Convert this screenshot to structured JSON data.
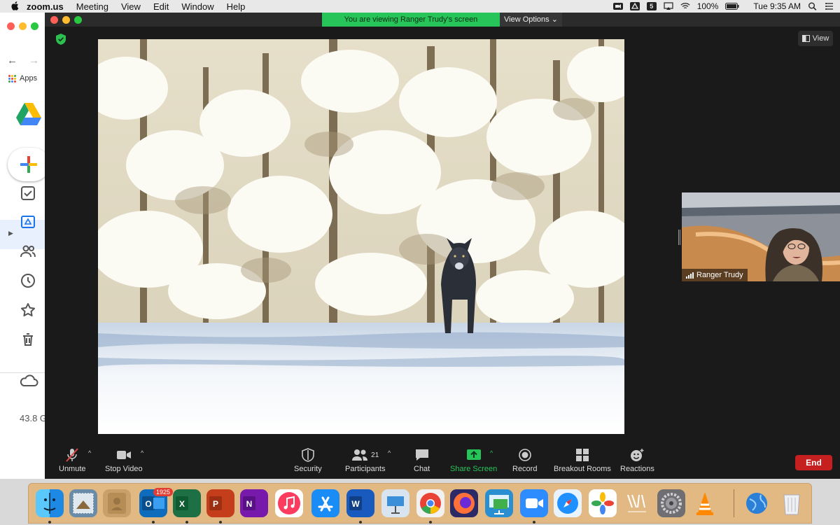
{
  "menubar": {
    "app_name": "zoom.us",
    "items": [
      "Meeting",
      "View",
      "Edit",
      "Window",
      "Help"
    ],
    "battery": "100%",
    "clock": "Tue 9:35 AM",
    "badge_five": "5"
  },
  "chrome": {
    "apps_label": "Apps",
    "storage_text": "43.8 G"
  },
  "zoom": {
    "banner": "You are viewing Ranger Trudy's screen",
    "view_options": "View Options ⌄",
    "view_button": "View",
    "participant_name": "Ranger Trudy",
    "toolbar": {
      "unmute": "Unmute",
      "stop_video": "Stop Video",
      "security": "Security",
      "participants": "Participants",
      "participants_count": "21",
      "chat": "Chat",
      "share_screen": "Share Screen",
      "record": "Record",
      "breakout_rooms": "Breakout Rooms",
      "reactions": "Reactions",
      "end": "End"
    }
  },
  "dock": {
    "outlook_badge": "1925",
    "icons": [
      "finder-icon",
      "mail-stamp-icon",
      "contacts-icon",
      "outlook-icon",
      "excel-icon",
      "powerpoint-icon",
      "onenote-icon",
      "music-icon",
      "app-store-icon",
      "word-icon",
      "keynote-icon",
      "chrome-icon",
      "firefox-icon",
      "remote-desktop-icon",
      "zoom-icon",
      "safari-icon",
      "photos-icon",
      "idd-icon",
      "system-preferences-icon",
      "vlc-icon",
      "network-globe-icon",
      "trash-icon"
    ]
  },
  "colors": {
    "banner_green": "#27c45a",
    "end_red": "#c61f1f",
    "share_green": "#27c45a",
    "dock_tan": "#e3b983"
  }
}
